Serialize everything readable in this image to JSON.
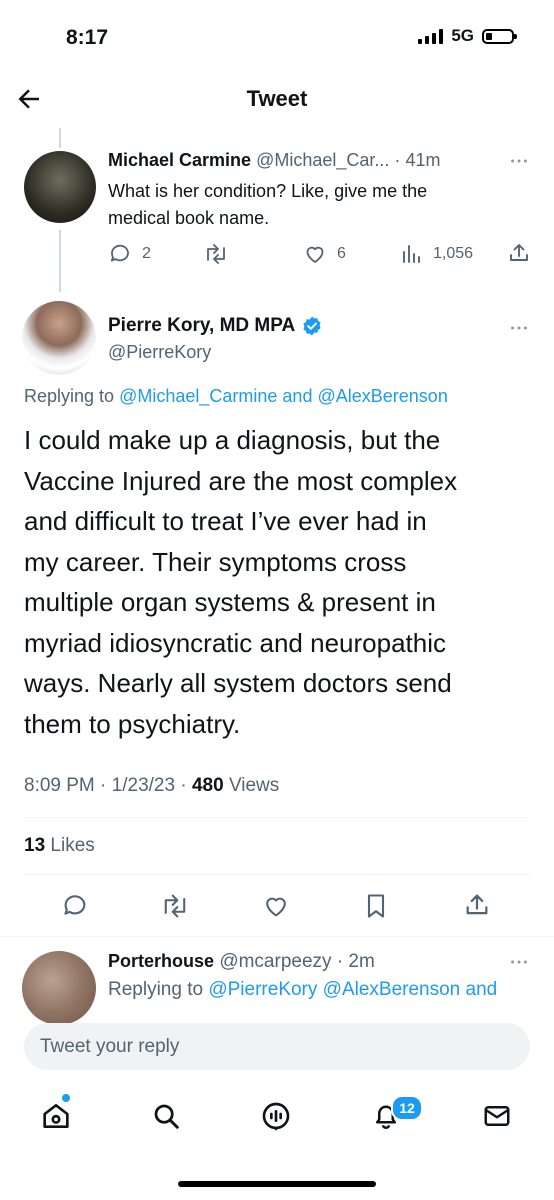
{
  "status_bar": {
    "time": "8:17",
    "network": "5G"
  },
  "header": {
    "title": "Tweet"
  },
  "parent_tweet": {
    "name": "Michael Carmine",
    "handle": "@Michael_Car...",
    "separator": "·",
    "time": "41m",
    "text_line1": "What is her condition?  Like, give me  the",
    "text_line2": "medical book name.",
    "replies": "2",
    "likes": "6",
    "views": "1,056"
  },
  "main_tweet": {
    "name": "Pierre Kory, MD MPA",
    "handle": "@PierreKory",
    "replying_prefix": "Replying to",
    "replying_user1": "@Michael_Carmine",
    "replying_and": "and",
    "replying_user2": "@AlexBerenson",
    "text_lines": [
      "I could make up a diagnosis, but the",
      "Vaccine Injured are the most complex",
      "and difficult to treat I’ve ever had in",
      "my career. Their symptoms cross",
      "multiple organ systems & present in",
      "myriad idiosyncratic and neuropathic",
      "ways. Nearly all system doctors send",
      "them to psychiatry."
    ],
    "time": "8:09 PM",
    "date": "1/23/23",
    "views_count": "480",
    "views_label": "Views",
    "likes_count": "13",
    "likes_label": "Likes"
  },
  "reply_tweet": {
    "name": "Porterhouse",
    "handle": "@mcarpeezy",
    "time": "2m",
    "replying_prefix": "Replying to",
    "replying_users": "@PierreKory @AlexBerenson and"
  },
  "compose": {
    "placeholder": "Tweet your reply"
  },
  "tab_bar": {
    "notifications_badge": "12"
  },
  "icons": [
    "back-arrow-icon",
    "reply-icon",
    "retweet-icon",
    "like-icon",
    "views-icon",
    "share-icon",
    "bookmark-icon",
    "verified-icon",
    "more-icon",
    "home-icon",
    "search-icon",
    "spaces-icon",
    "bell-icon",
    "mail-icon"
  ],
  "colors": {
    "accent": "#1d9bf0",
    "text": "#0f1419",
    "secondary": "#536471"
  }
}
